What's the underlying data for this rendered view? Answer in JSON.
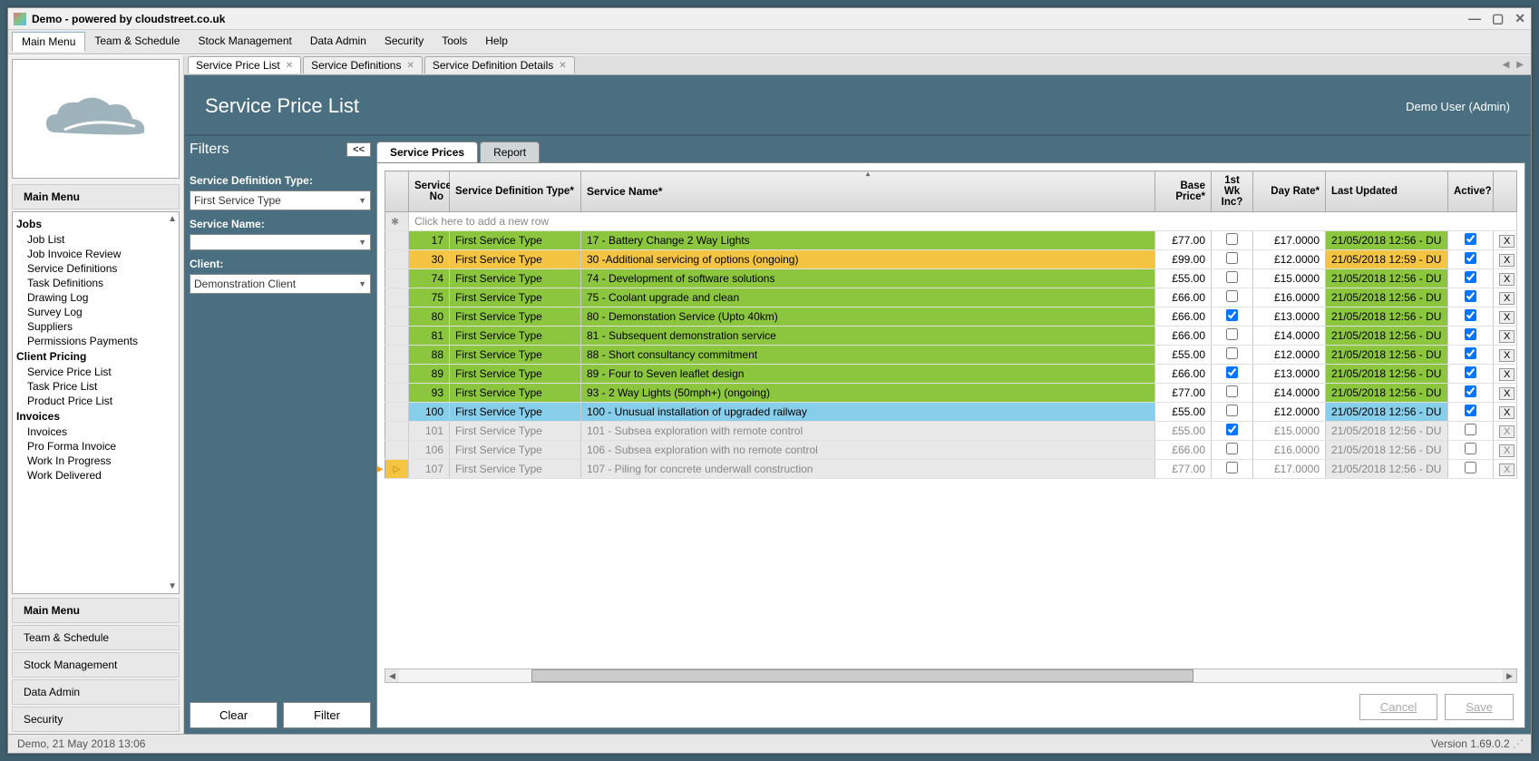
{
  "title": "Demo - powered by cloudstreet.co.uk",
  "menu": [
    "Main Menu",
    "Team & Schedule",
    "Stock Management",
    "Data Admin",
    "Security",
    "Tools",
    "Help"
  ],
  "tabs": [
    {
      "label": "Service Price List"
    },
    {
      "label": "Service Definitions"
    },
    {
      "label": "Service Definition Details"
    }
  ],
  "nav": {
    "title": "Main Menu",
    "groups": [
      {
        "header": "Jobs",
        "items": [
          "Job List",
          "Job Invoice Review",
          "Service Definitions",
          "Task Definitions",
          "Drawing Log",
          "Survey Log",
          "Suppliers",
          "Permissions Payments"
        ]
      },
      {
        "header": "Client Pricing",
        "items": [
          "Service Price List",
          "Task Price List",
          "Product Price List"
        ]
      },
      {
        "header": "Invoices",
        "items": [
          "Invoices",
          "Pro Forma Invoice",
          "Work In Progress",
          "Work Delivered"
        ]
      }
    ],
    "accordion": [
      "Main Menu",
      "Team & Schedule",
      "Stock Management",
      "Data Admin",
      "Security"
    ]
  },
  "page": {
    "title": "Service Price List",
    "user": "Demo User (Admin)"
  },
  "filters": {
    "title": "Filters",
    "collapse": "<<",
    "labels": {
      "type": "Service Definition Type:",
      "name": "Service Name:",
      "client": "Client:"
    },
    "values": {
      "type": "First Service Type",
      "name": "",
      "client": "Demonstration Client"
    },
    "buttons": {
      "clear": "Clear",
      "filter": "Filter"
    }
  },
  "sub_tabs": [
    "Service Prices",
    "Report"
  ],
  "grid": {
    "headers": {
      "no": "Service No",
      "type": "Service Definition Type*",
      "name": "Service Name*",
      "base": "Base Price*",
      "wk": "1st Wk Inc?",
      "rate": "Day Rate*",
      "updated": "Last Updated",
      "active": "Active?",
      "delete": ""
    },
    "new_row_text": "Click here to add a new row",
    "rows": [
      {
        "no": "17",
        "type": "First Service Type",
        "name": "17 - Battery Change 2 Way Lights",
        "base": "£77.00",
        "wk": false,
        "rate": "£17.0000",
        "updated": "21/05/2018 12:56 - DU",
        "active": true,
        "color": "green"
      },
      {
        "no": "30",
        "type": "First Service Type",
        "name": "30 -Additional servicing of options (ongoing)",
        "base": "£99.00",
        "wk": false,
        "rate": "£12.0000",
        "updated": "21/05/2018 12:59 - DU",
        "active": true,
        "color": "yellow"
      },
      {
        "no": "74",
        "type": "First Service Type",
        "name": "74 - Development of software solutions",
        "base": "£55.00",
        "wk": false,
        "rate": "£15.0000",
        "updated": "21/05/2018 12:56 - DU",
        "active": true,
        "color": "green"
      },
      {
        "no": "75",
        "type": "First Service Type",
        "name": "75 - Coolant upgrade and clean",
        "base": "£66.00",
        "wk": false,
        "rate": "£16.0000",
        "updated": "21/05/2018 12:56 - DU",
        "active": true,
        "color": "green"
      },
      {
        "no": "80",
        "type": "First Service Type",
        "name": "80 - Demonstation Service (Upto 40km)",
        "base": "£66.00",
        "wk": true,
        "rate": "£13.0000",
        "updated": "21/05/2018 12:56 - DU",
        "active": true,
        "color": "green"
      },
      {
        "no": "81",
        "type": "First Service Type",
        "name": "81 - Subsequent demonstration service",
        "base": "£66.00",
        "wk": false,
        "rate": "£14.0000",
        "updated": "21/05/2018 12:56 - DU",
        "active": true,
        "color": "green"
      },
      {
        "no": "88",
        "type": "First Service Type",
        "name": "88 - Short consultancy commitment",
        "base": "£55.00",
        "wk": false,
        "rate": "£12.0000",
        "updated": "21/05/2018 12:56 - DU",
        "active": true,
        "color": "green"
      },
      {
        "no": "89",
        "type": "First Service Type",
        "name": "89 - Four to Seven leaflet design",
        "base": "£66.00",
        "wk": true,
        "rate": "£13.0000",
        "updated": "21/05/2018 12:56 - DU",
        "active": true,
        "color": "green"
      },
      {
        "no": "93",
        "type": "First Service Type",
        "name": "93 - 2 Way Lights (50mph+) (ongoing)",
        "base": "£77.00",
        "wk": false,
        "rate": "£14.0000",
        "updated": "21/05/2018 12:56 - DU",
        "active": true,
        "color": "green"
      },
      {
        "no": "100",
        "type": "First Service Type",
        "name": "100 - Unusual installation of upgraded railway",
        "base": "£55.00",
        "wk": false,
        "rate": "£12.0000",
        "updated": "21/05/2018 12:56 - DU",
        "active": true,
        "color": "blue"
      },
      {
        "no": "101",
        "type": "First Service Type",
        "name": "101 - Subsea exploration with remote control",
        "base": "£55.00",
        "wk": true,
        "rate": "£15.0000",
        "updated": "21/05/2018 12:56 - DU",
        "active": false,
        "color": "grey"
      },
      {
        "no": "106",
        "type": "First Service Type",
        "name": "106 - Subsea exploration with no remote control",
        "base": "£66.00",
        "wk": false,
        "rate": "£16.0000",
        "updated": "21/05/2018 12:56 - DU",
        "active": false,
        "color": "grey"
      },
      {
        "no": "107",
        "type": "First Service Type",
        "name": "107 - Piling for concrete underwall construction",
        "base": "£77.00",
        "wk": false,
        "rate": "£17.0000",
        "updated": "21/05/2018 12:56 - DU",
        "active": false,
        "color": "grey",
        "current": true
      }
    ]
  },
  "actions": {
    "cancel": "Cancel",
    "save": "Save"
  },
  "status": {
    "left": "Demo, 21 May 2018 13:06",
    "right": "Version 1.69.0.2"
  }
}
